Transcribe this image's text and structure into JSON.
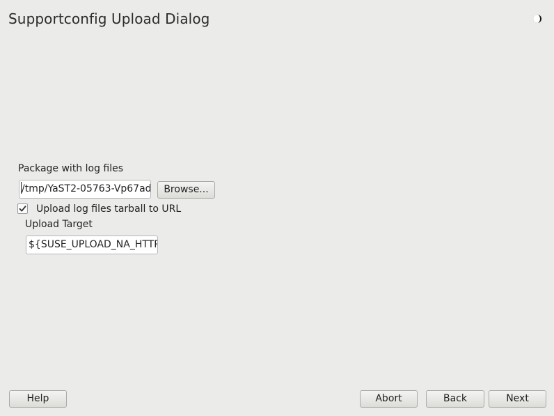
{
  "window": {
    "title": "Supportconfig Upload Dialog",
    "theme_toggle_icon": "half-moon-icon"
  },
  "form": {
    "package_label": "Package with log files",
    "package_value": "/tmp/YaST2-05763-Vp67ad",
    "browse_label": "Browse...",
    "upload_checkbox_label": "Upload log files tarball to URL",
    "upload_checked": true,
    "upload_target_label": "Upload Target",
    "upload_target_value": "${SUSE_UPLOAD_NA_HTTP"
  },
  "footer": {
    "help_label": "Help",
    "abort_label": "Abort",
    "back_label": "Back",
    "next_label": "Next"
  }
}
